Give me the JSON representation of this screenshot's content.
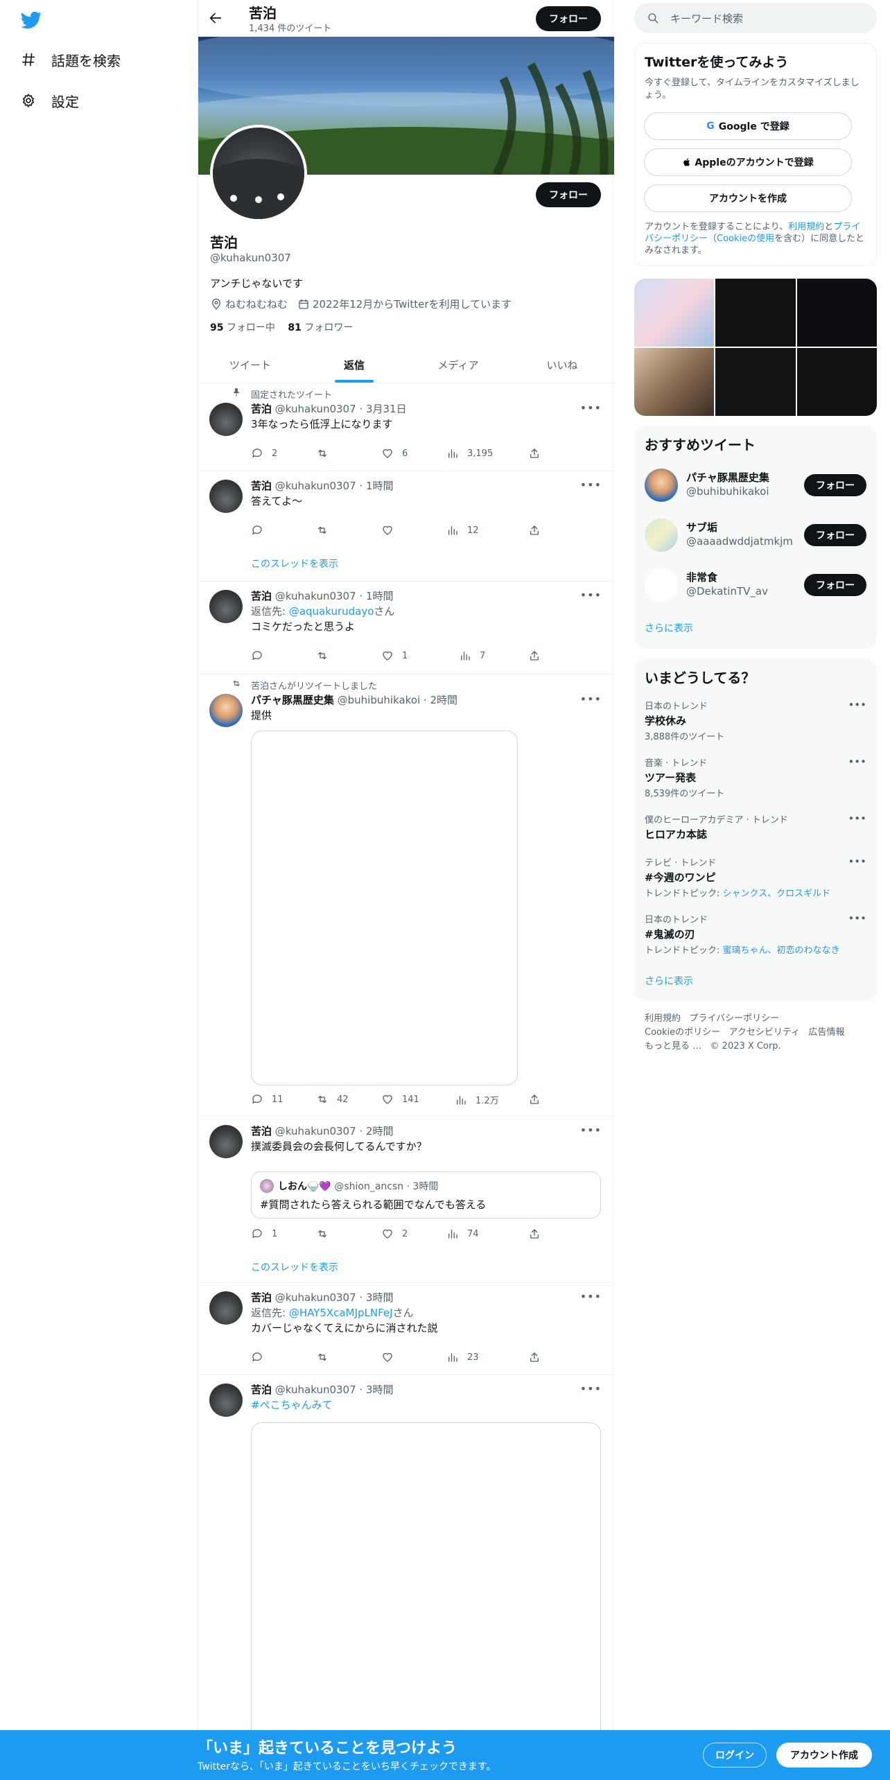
{
  "nav": {
    "explore_label": "話題を検索",
    "settings_label": "設定"
  },
  "header": {
    "name": "苦泊",
    "tweet_count": "1,434 件のツイート",
    "follow_label": "フォロー"
  },
  "profile": {
    "name": "苦泊",
    "handle": "@kuhakun0307",
    "bio": "アンチじゃないです",
    "location": "ねむねむねむ",
    "joined": "2022年12月からTwitterを利用しています",
    "following_count": "95",
    "following_label": "フォロー中",
    "followers_count": "81",
    "followers_label": "フォロワー",
    "follow_label": "フォロー"
  },
  "tabs": [
    "ツイート",
    "返信",
    "メディア",
    "いいね"
  ],
  "tweets": [
    {
      "context": "固定されたツイート",
      "name": "苦泊",
      "meta": "@kuhakun0307 · 3月31日",
      "text": "3年なったら低浮上になります",
      "replies": "2",
      "retweets": "",
      "likes": "6",
      "views": "3,195"
    },
    {
      "name": "苦泊",
      "meta": "@kuhakun0307 · 1時間",
      "text": "答えてよ〜",
      "replies": "",
      "retweets": "",
      "likes": "",
      "views": "12",
      "thread": "このスレッドを表示"
    },
    {
      "name": "苦泊",
      "meta": "@kuhakun0307 · 1時間",
      "reply_prefix": "返信先: ",
      "reply_to": "@aquakurudayo",
      "reply_suffix": "さん",
      "text": "コミケだったと思うよ",
      "replies": "",
      "retweets": "",
      "likes": "1",
      "views": "7"
    },
    {
      "context": "苦泊さんがリツイートしました",
      "name": "パチャ豚黒歴史集",
      "meta": "@buhibuhikakoi · 2時間",
      "text": "提供",
      "replies": "11",
      "retweets": "42",
      "likes": "141",
      "views": "1.2万"
    },
    {
      "name": "苦泊",
      "meta": "@kuhakun0307 · 2時間",
      "text": "撲滅委員会の会長何してるんですか？",
      "quote_name": "しおん🍚💜",
      "quote_meta": "@shion_ancsn · 3時間",
      "quote_text": "#質問されたら答えられる範囲でなんでも答える",
      "replies": "1",
      "retweets": "",
      "likes": "2",
      "views": "74",
      "thread": "このスレッドを表示"
    },
    {
      "name": "苦泊",
      "meta": "@kuhakun0307 · 3時間",
      "reply_prefix": "返信先: ",
      "reply_to": "@HAY5XcaMJpLNFeJ",
      "reply_suffix": "さん",
      "text": "カバーじゃなくてえにからに消された説",
      "replies": "",
      "retweets": "",
      "likes": "",
      "views": "23"
    },
    {
      "name": "苦泊",
      "meta": "@kuhakun0307 · 3時間",
      "text": "#ぺこちゃんみて"
    }
  ],
  "right": {
    "search_placeholder": "キーワード検索",
    "signup_card": {
      "title": "Twitterを使ってみよう",
      "desc": "今すぐ登録して、タイムラインをカスタマイズしましょう。",
      "google": "Google で登録",
      "apple": "Appleのアカウントで登録",
      "create": "アカウントを作成",
      "terms_pre": "アカウントを登録することにより、",
      "terms_link1": "利用規約",
      "terms_mid": "と",
      "terms_link2": "プライバシーポリシー",
      "terms_paren_open": "（",
      "terms_link3": "Cookieの使用",
      "terms_post": "を含む）に同意したとみなされます。"
    },
    "suggested": {
      "title": "おすすめツイート",
      "users": [
        {
          "name": "パチャ豚黒歴史集",
          "handle": "@buhibuhikakoi",
          "follow": "フォロー"
        },
        {
          "name": "サブ垢",
          "handle": "@aaaadwddjatmkjm",
          "follow": "フォロー"
        },
        {
          "name": "非常食",
          "handle": "@DekatinTV_av",
          "follow": "フォロー"
        }
      ],
      "more": "さらに表示"
    },
    "trends": {
      "title": "いまどうしてる？",
      "items": [
        {
          "context": "日本のトレンド",
          "name": "学校休み",
          "sub": "3,888件のツイート"
        },
        {
          "context": "音楽 · トレンド",
          "name": "ツアー発表",
          "sub": "8,539件のツイート"
        },
        {
          "context": "僕のヒーローアカデミア · トレンド",
          "name": "ヒロアカ本誌",
          "sub": ""
        },
        {
          "context": "テレビ · トレンド",
          "name": "#今週のワンピ",
          "sub_prefix": "トレンドトピック: ",
          "sub_links": "シャンクス、クロスギルド"
        },
        {
          "context": "日本のトレンド",
          "name": "#鬼滅の刃",
          "sub_prefix": "トレンドトピック: ",
          "sub_links": "蜜璃ちゃん、初恋のわななき"
        }
      ],
      "more": "さらに表示"
    },
    "footer": [
      "利用規約",
      "プライバシーポリシー",
      "Cookieのポリシー",
      "アクセシビリティ",
      "広告情報",
      "もっと見る …",
      "© 2023 X Corp."
    ]
  },
  "bottom": {
    "title": "「いま」起きていることを見つけよう",
    "subtitle": "Twitterなら、「いま」起きていることをいち早くチェックできます。",
    "login": "ログイン",
    "signup": "アカウント作成"
  },
  "colors": {
    "accent": "#1d9bf0",
    "text": "#0f1419",
    "muted": "#536471"
  }
}
